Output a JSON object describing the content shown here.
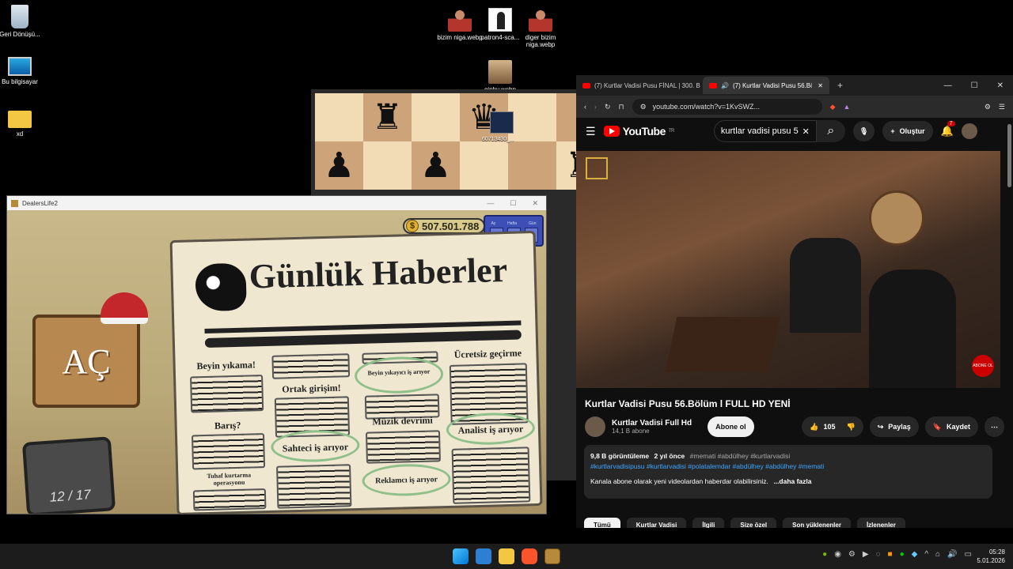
{
  "desktop": {
    "icons": [
      {
        "label": "Geri Dönüşü..."
      },
      {
        "label": "Bu bilgisayar"
      },
      {
        "label": "xd"
      },
      {
        "label": "bizim niga.webp"
      },
      {
        "label": "patron4-sca..."
      },
      {
        "label": "diger bizim niga.webp"
      },
      {
        "label": "giphy.webp"
      }
    ],
    "chess_overlay_label": "60713430_..."
  },
  "game": {
    "window_title": "DealersLife2",
    "money": "507.501.788",
    "date_labels": [
      "Ay",
      "Hafta",
      "Gün"
    ],
    "date_values": [
      "104",
      "3",
      "3"
    ],
    "open_button": "AÇ",
    "counter": "12 / 17",
    "newspaper": {
      "title": "Günlük Haberler",
      "headings": {
        "beyin_yikama": "Beyin yıkama!",
        "ortak_girisim": "Ortak girişim!",
        "beyin_yikayici": "Beyin yıkayıcı iş arıyor",
        "ucretsiz_gecirme": "Ücretsiz geçirme",
        "baris": "Barış?",
        "muzik_devrimi": "Müzik devrimi",
        "sahteci": "Sahteci iş arıyor",
        "analist": "Analist iş arıyor",
        "tuhaf_kurtarma": "Tuhaf kurtarma operasyonu",
        "reklamci": "Reklamcı iş arıyor"
      }
    }
  },
  "browser": {
    "tabs": [
      {
        "label": "(7) Kurtlar Vadisi Pusu FİNAL | 300. B"
      },
      {
        "label": "(7) Kurtlar Vadisi Pusu 56.Bölü"
      }
    ],
    "url": "youtube.com/watch?v=1KvSWZ...",
    "youtube": {
      "logo": "YouTube",
      "logo_sup": "TR",
      "search_value": "kurtlar vadisi pusu 5",
      "create_label": "Oluştur",
      "notif_count": "7",
      "video_title": "Kurtlar Vadisi Pusu 56.Bölüm l FULL HD YENİ",
      "channel": "Kurtlar Vadisi Full Hd",
      "subscribers": "14,1 B abone",
      "subscribe_label": "Abone ol",
      "likes": "105",
      "share_label": "Paylaş",
      "save_label": "Kaydet",
      "views": "9,8 B görüntüleme",
      "age": "2 yıl önce",
      "tags1": "#memati #abdülhey #kurtlarvadisi",
      "tags2": "#kurtlarvadisipusu #kurtlarvadisi #polatalemdar #abdülhey #abdülhey #memati",
      "desc_text": "Kanala abone olarak yeni videolardan haberdar olabilirsiniz.",
      "more": "...daha fazla",
      "chips": [
        "Tümü",
        "Kurtlar Vadisi",
        "İlgili",
        "Size özel",
        "Son yüklenenler",
        "İzlenenler"
      ],
      "watermark": "ABONE OL"
    }
  },
  "taskbar": {
    "time": "05:28",
    "date": "5.01.2026"
  }
}
